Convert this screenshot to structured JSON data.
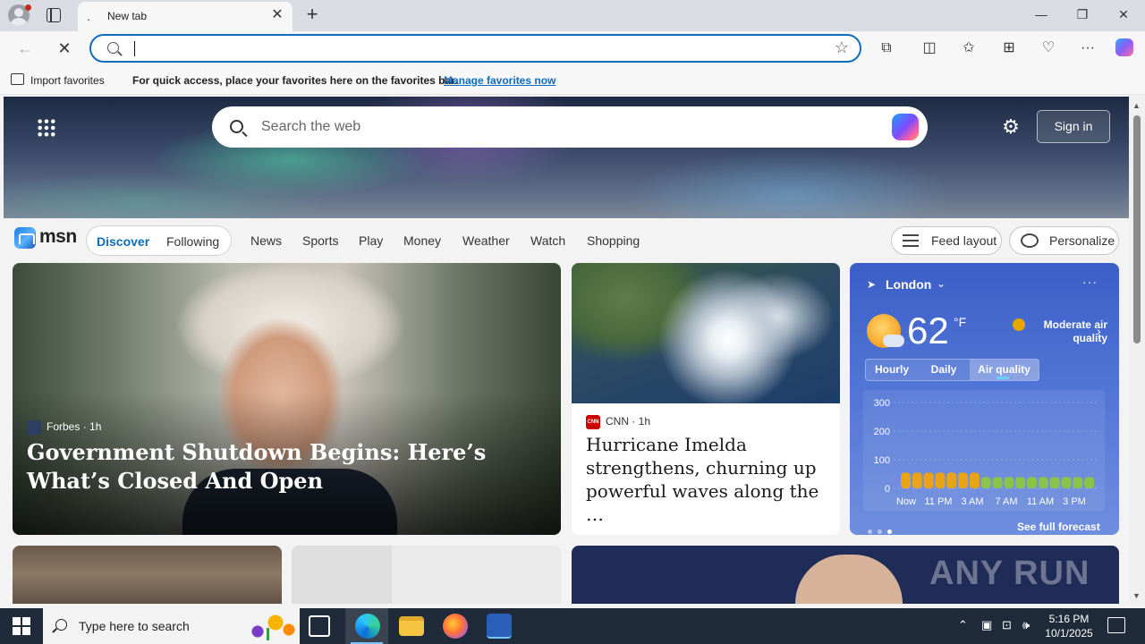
{
  "browser": {
    "tab_title": "New tab",
    "new_tab_symbol": "+",
    "window_controls": [
      "—",
      "❐",
      "✕"
    ],
    "address_value": "",
    "favorites_bar": {
      "import_label": "Import favorites",
      "message": "For quick access, place your favorites here on the favorites bar.",
      "link": "Manage favorites now"
    },
    "icons": [
      "back-icon",
      "stop-icon",
      "search-icon",
      "favorite-star-icon",
      "extensions-icon",
      "split-screen-icon",
      "favorites-icon",
      "collections-icon",
      "browser-essentials-icon",
      "more-icon",
      "copilot-icon"
    ],
    "accent_color": "#0f6cbd"
  },
  "msn": {
    "search_placeholder": "Search the web",
    "sign_in": "Sign in",
    "logo_text": "msn",
    "tabs": {
      "discover": "Discover",
      "following": "Following"
    },
    "nav_links": [
      "News",
      "Sports",
      "Play",
      "Money",
      "Weather",
      "Watch",
      "Shopping"
    ],
    "feed_layout": "Feed layout",
    "personalize": "Personalize"
  },
  "cards": {
    "main": {
      "source": "Forbes",
      "time": "1h",
      "headline": "Government Shutdown Begins: Here’s What’s Closed And Open"
    },
    "cnn": {
      "source": "CNN",
      "time": "1h",
      "headline": "Hurricane Imelda strengthens, churning up powerful waves along the …"
    },
    "watermark": "ANY RUN"
  },
  "weather": {
    "city": "London",
    "temperature": "62",
    "unit": "°F",
    "air_quality": "Moderate air quality",
    "tabs": [
      "Hourly",
      "Daily",
      "Air quality"
    ],
    "active_tab": "Air quality",
    "see_full": "See full forecast",
    "chart_data": {
      "type": "bar",
      "y_ticks": [
        "300",
        "200",
        "100",
        "0"
      ],
      "ylim": [
        0,
        300
      ],
      "x_labels": [
        "Now",
        "11 PM",
        "3 AM",
        "7 AM",
        "11 AM",
        "3 PM"
      ],
      "values": [
        55,
        55,
        55,
        55,
        55,
        55,
        55,
        40,
        40,
        40,
        40,
        40,
        40,
        40,
        40,
        40,
        40
      ],
      "colors": [
        "#e8a317",
        "#e8a317",
        "#e8a317",
        "#e8a317",
        "#e8a317",
        "#e8a317",
        "#e8a317",
        "#8bc34a",
        "#8bc34a",
        "#8bc34a",
        "#8bc34a",
        "#8bc34a",
        "#8bc34a",
        "#8bc34a",
        "#8bc34a",
        "#8bc34a",
        "#8bc34a"
      ]
    }
  },
  "taskbar": {
    "search_placeholder": "Type here to search",
    "time": "5:16 PM",
    "date": "10/1/2025"
  }
}
